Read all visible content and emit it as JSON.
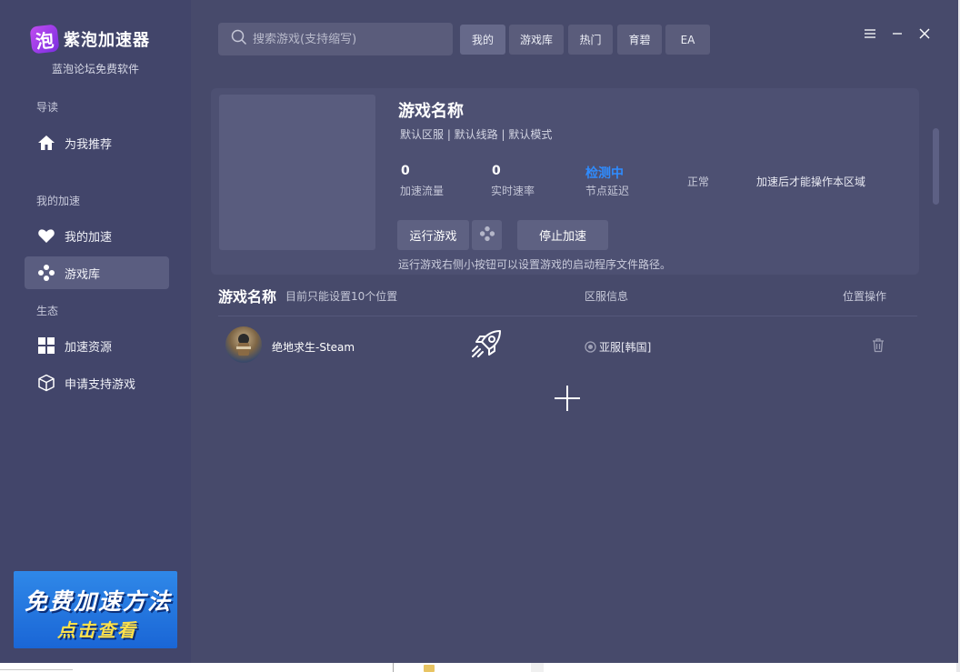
{
  "app": {
    "logo_glyph": "泡",
    "name": "紫泡加速器",
    "subtitle": "蓝泡论坛免费软件"
  },
  "sidebar": {
    "sections": [
      {
        "label": "导读"
      },
      {
        "label": "我的加速"
      },
      {
        "label": "生态"
      }
    ],
    "items": [
      {
        "label": "为我推荐",
        "icon": "home-icon"
      },
      {
        "label": "我的加速",
        "icon": "heart-icon"
      },
      {
        "label": "游戏库",
        "icon": "gamepad-icon",
        "active": true
      },
      {
        "label": "加速资源",
        "icon": "grid-icon"
      },
      {
        "label": "申请支持游戏",
        "icon": "cube-icon"
      }
    ],
    "promo": {
      "line1": "免费加速方法",
      "line2": "点击查看"
    }
  },
  "search": {
    "placeholder": "搜索游戏(支持缩写)"
  },
  "tabs": [
    {
      "label": "我的",
      "active": true
    },
    {
      "label": "游戏库"
    },
    {
      "label": "热门"
    },
    {
      "label": "育碧"
    },
    {
      "label": "EA"
    }
  ],
  "game_card": {
    "title": "游戏名称",
    "subtitle": "默认区服 | 默认线路 | 默认模式",
    "stats": [
      {
        "value": "0",
        "label": "加速流量"
      },
      {
        "value": "0",
        "label": "实时速率"
      },
      {
        "value": "检测中",
        "label": "节点延迟"
      }
    ],
    "status": "正常",
    "hint": "加速后才能操作本区域",
    "run_button": "运行游戏",
    "stop_button": "停止加速",
    "note": "运行游戏右侧小按钮可以设置游戏的启动程序文件路径。"
  },
  "list": {
    "title": "游戏名称",
    "note": "目前只能设置10个位置",
    "col_server": "区服信息",
    "col_action": "位置操作",
    "rows": [
      {
        "name": "绝地求生-Steam",
        "server": "亚服[韩国]"
      }
    ]
  },
  "colors": {
    "app_bg": "#474a6b",
    "sidebar_bg": "#42456a",
    "accent_blue": "#2f8cff"
  }
}
